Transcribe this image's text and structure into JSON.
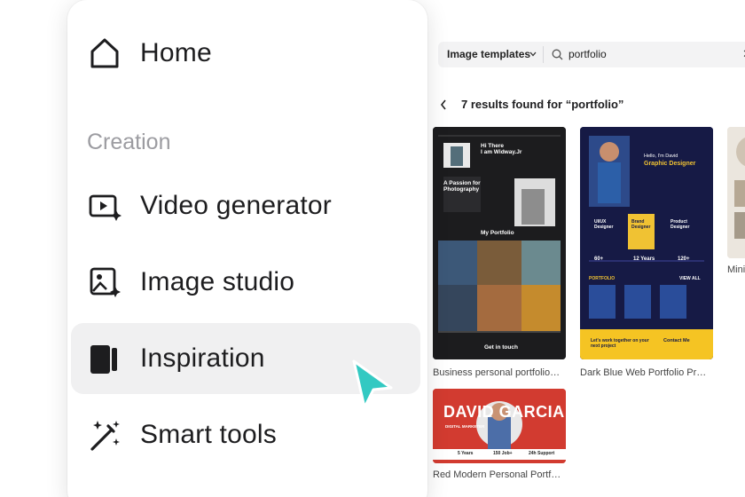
{
  "menu": {
    "items": [
      {
        "label": "Home",
        "icon": "home-icon"
      },
      {
        "label": "Video generator",
        "icon": "video-generator-icon"
      },
      {
        "label": "Image studio",
        "icon": "image-studio-icon"
      },
      {
        "label": "Inspiration",
        "icon": "inspiration-icon"
      },
      {
        "label": "Smart tools",
        "icon": "smart-tools-icon"
      }
    ],
    "section_title": "Creation",
    "active": "Inspiration"
  },
  "search": {
    "type_label": "Image templates",
    "query": "portfolio"
  },
  "results": {
    "heading": "7 results found for “portfolio”",
    "cards": [
      {
        "caption": "Business personal portfolio…"
      },
      {
        "caption": "Dark Blue Web Portfolio Pr…"
      },
      {
        "caption": "Mini"
      },
      {
        "caption": "Red Modern Personal Portf…"
      }
    ]
  },
  "card1": {
    "greeting": "Hi There\nI am Widway.Jr",
    "section": "A Passion for Photography",
    "portfolio": "My Portfolio",
    "cta": "Get in touch"
  },
  "card2": {
    "hello": "Hello, I'm David",
    "role": "Graphic Designer",
    "skills": [
      "UI/UX Designer",
      "Brand Designer",
      "Product Designer"
    ],
    "stats": [
      "60+",
      "12 Years",
      "120+"
    ],
    "portfolio": "PORTFOLIO",
    "view_all": "VIEW ALL",
    "cta": "Let's work together on your next project",
    "contact": "Contact Me"
  },
  "card4": {
    "name": "DAVID GARCIA",
    "title": "DIGITAL MARKETER",
    "stats": [
      "5 Years",
      "150 Job+",
      "24h Support"
    ]
  },
  "colors": {
    "accent": "#1f8a8a",
    "active_bg": "#f0f0f1",
    "cursor": "#33c9c2"
  }
}
